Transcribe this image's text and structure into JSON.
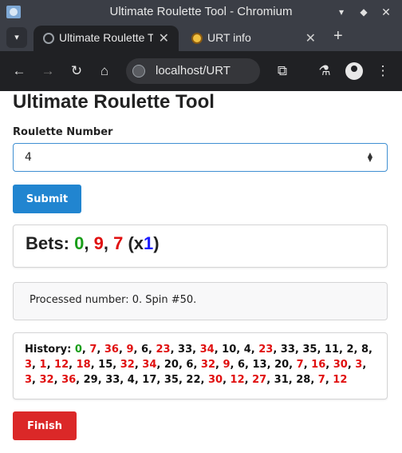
{
  "window": {
    "title": "Ultimate Roulette Tool - Chromium",
    "min_glyph": "▾",
    "max_glyph": "◆",
    "close_glyph": "✕"
  },
  "tabs": {
    "menu_glyph": "▾",
    "items": [
      {
        "label": "Ultimate Roulette Tool",
        "close": "✕"
      },
      {
        "label": "URT info",
        "close": "✕"
      }
    ],
    "new_tab_glyph": "+"
  },
  "toolbar": {
    "back_glyph": "←",
    "forward_glyph": "→",
    "reload_glyph": "↻",
    "home_glyph": "⌂",
    "url": "localhost/URT",
    "extensions_glyph": "⧉",
    "labs_glyph": "⚗",
    "menu_glyph": "⋮"
  },
  "page": {
    "title": "Ultimate Roulette Tool",
    "field_label": "Roulette Number",
    "input_value": "4",
    "submit_label": "Submit",
    "bets": {
      "prefix": "Bets: ",
      "numbers": [
        {
          "n": "0",
          "color": "green"
        },
        {
          "n": "9",
          "color": "red"
        },
        {
          "n": "7",
          "color": "red"
        }
      ],
      "multiplier_prefix": "(x",
      "multiplier": "1",
      "multiplier_suffix": ")"
    },
    "status": "Processed number: 0. Spin #50.",
    "history": {
      "prefix": "History: ",
      "numbers": [
        {
          "n": "0",
          "color": "green"
        },
        {
          "n": "7",
          "color": "red"
        },
        {
          "n": "36",
          "color": "red"
        },
        {
          "n": "9",
          "color": "red"
        },
        {
          "n": "6",
          "color": "black"
        },
        {
          "n": "23",
          "color": "red"
        },
        {
          "n": "33",
          "color": "black"
        },
        {
          "n": "34",
          "color": "red"
        },
        {
          "n": "10",
          "color": "black"
        },
        {
          "n": "4",
          "color": "black"
        },
        {
          "n": "23",
          "color": "red"
        },
        {
          "n": "33",
          "color": "black"
        },
        {
          "n": "35",
          "color": "black"
        },
        {
          "n": "11",
          "color": "black"
        },
        {
          "n": "2",
          "color": "black"
        },
        {
          "n": "8",
          "color": "black"
        },
        {
          "n": "3",
          "color": "red"
        },
        {
          "n": "1",
          "color": "red"
        },
        {
          "n": "12",
          "color": "red"
        },
        {
          "n": "18",
          "color": "red"
        },
        {
          "n": "15",
          "color": "black"
        },
        {
          "n": "32",
          "color": "red"
        },
        {
          "n": "34",
          "color": "red"
        },
        {
          "n": "20",
          "color": "black"
        },
        {
          "n": "6",
          "color": "black"
        },
        {
          "n": "32",
          "color": "red"
        },
        {
          "n": "9",
          "color": "red"
        },
        {
          "n": "6",
          "color": "black"
        },
        {
          "n": "13",
          "color": "black"
        },
        {
          "n": "20",
          "color": "black"
        },
        {
          "n": "7",
          "color": "red"
        },
        {
          "n": "16",
          "color": "red"
        },
        {
          "n": "30",
          "color": "red"
        },
        {
          "n": "3",
          "color": "red"
        },
        {
          "n": "3",
          "color": "red"
        },
        {
          "n": "32",
          "color": "red"
        },
        {
          "n": "36",
          "color": "red"
        },
        {
          "n": "29",
          "color": "black"
        },
        {
          "n": "33",
          "color": "black"
        },
        {
          "n": "4",
          "color": "black"
        },
        {
          "n": "17",
          "color": "black"
        },
        {
          "n": "35",
          "color": "black"
        },
        {
          "n": "22",
          "color": "black"
        },
        {
          "n": "30",
          "color": "red"
        },
        {
          "n": "12",
          "color": "red"
        },
        {
          "n": "27",
          "color": "red"
        },
        {
          "n": "31",
          "color": "black"
        },
        {
          "n": "28",
          "color": "black"
        },
        {
          "n": "7",
          "color": "red"
        },
        {
          "n": "12",
          "color": "red"
        }
      ]
    },
    "finish_label": "Finish"
  },
  "colors": {
    "primary": "#2185d0",
    "danger": "#db2828",
    "roulette_green": "#1a9e1a",
    "roulette_red": "#e01010",
    "multiplier_blue": "#1a1aff"
  }
}
